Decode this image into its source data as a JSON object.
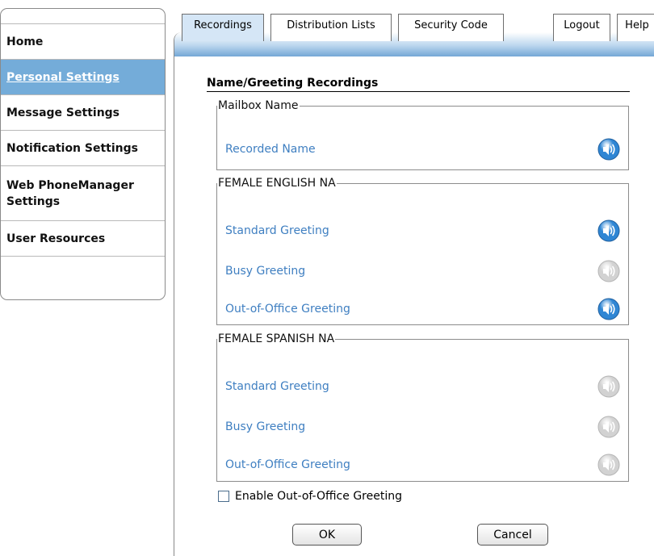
{
  "sidebar": {
    "items": [
      {
        "label": "Home"
      },
      {
        "label": "Personal Settings"
      },
      {
        "label": "Message Settings"
      },
      {
        "label": "Notification Settings"
      },
      {
        "label": "Web PhoneManager Settings",
        "line1": "Web PhoneManager",
        "line2": "Settings"
      },
      {
        "label": "User Resources"
      }
    ],
    "active_index": 1
  },
  "tabs": {
    "recordings": "Recordings",
    "distribution_lists": "Distribution Lists",
    "security_code": "Security Code",
    "logout": "Logout",
    "help": "Help"
  },
  "section_title": "Name/Greeting Recordings",
  "groups": {
    "mailbox": {
      "legend": "Mailbox Name",
      "rows": [
        {
          "label": "Recorded Name",
          "playable": true
        }
      ]
    },
    "english": {
      "legend": "FEMALE ENGLISH NA",
      "rows": [
        {
          "label": "Standard Greeting",
          "playable": true
        },
        {
          "label": "Busy Greeting",
          "playable": false
        },
        {
          "label": "Out-of-Office Greeting",
          "playable": true
        }
      ]
    },
    "spanish": {
      "legend": "FEMALE SPANISH NA",
      "rows": [
        {
          "label": "Standard Greeting",
          "playable": false
        },
        {
          "label": "Busy Greeting",
          "playable": false
        },
        {
          "label": "Out-of-Office Greeting",
          "playable": false
        }
      ]
    }
  },
  "enable_ooo": {
    "label": "Enable Out-of-Office Greeting",
    "checked": false
  },
  "buttons": {
    "ok": "OK",
    "cancel": "Cancel"
  },
  "icons": {
    "speaker": "speaker-icon"
  },
  "colors": {
    "active_nav": "#74acd9",
    "link_text": "#3f7fc1",
    "speaker_active": "#2f86d4",
    "speaker_inactive": "#d2d2d2"
  }
}
